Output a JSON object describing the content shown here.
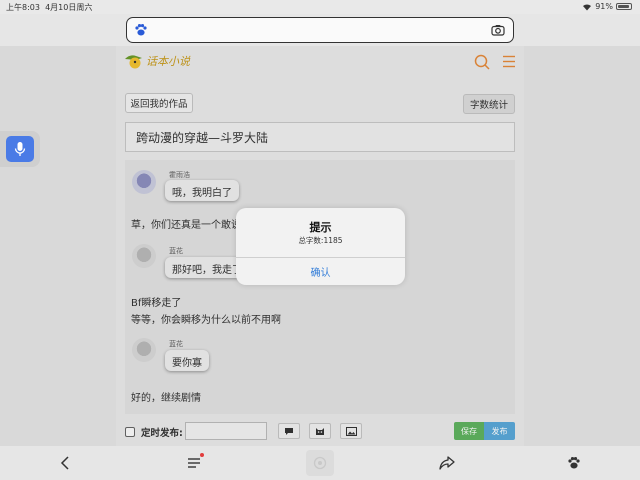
{
  "status": {
    "time": "上午8:03",
    "date": "4月10日周六",
    "battery": "91%",
    "battery_level": 0.91
  },
  "addressbar": {
    "value": "",
    "placeholder": ""
  },
  "header": {
    "logo_text": "话本小说"
  },
  "editor": {
    "back_label": "返回我的作品",
    "word_count_label": "字数统计",
    "title": "跨动漫的穿越—斗罗大陆"
  },
  "story": {
    "line1_speaker": "霍雨浩",
    "line1_text": "哦，我明白了",
    "narr1": "草，你们还真是一个敢说",
    "line2_speaker": "蓝花",
    "line2_text": "那好吧，我走了",
    "narr2": "Bf瞬移走了",
    "narr3": "等等，你会瞬移为什么以前不用啊",
    "line3_speaker": "蓝花",
    "line3_text": "要你寡",
    "narr4": "好的，继续剧情"
  },
  "bottom": {
    "schedule_label": "定时发布:",
    "time_value": "",
    "save_label": "保存",
    "publish_label": "发布"
  },
  "alert": {
    "title": "提示",
    "message": "总字数:1185",
    "confirm_label": "确认"
  },
  "colors": {
    "accent_blue": "#2f7bd8",
    "save_green": "#5fb35f",
    "publish_blue": "#5aa8d8",
    "voice_blue": "#4a7be6",
    "logo_orange": "#e58a3a"
  },
  "icons": {
    "addressbar_left": "paw-icon",
    "addressbar_right": "camera-icon",
    "header_search": "search-icon",
    "header_menu": "menu-icon",
    "voice": "microphone-icon",
    "toolbar": [
      "back-icon",
      "list-icon",
      "home-icon",
      "share-icon",
      "paw-icon"
    ]
  }
}
